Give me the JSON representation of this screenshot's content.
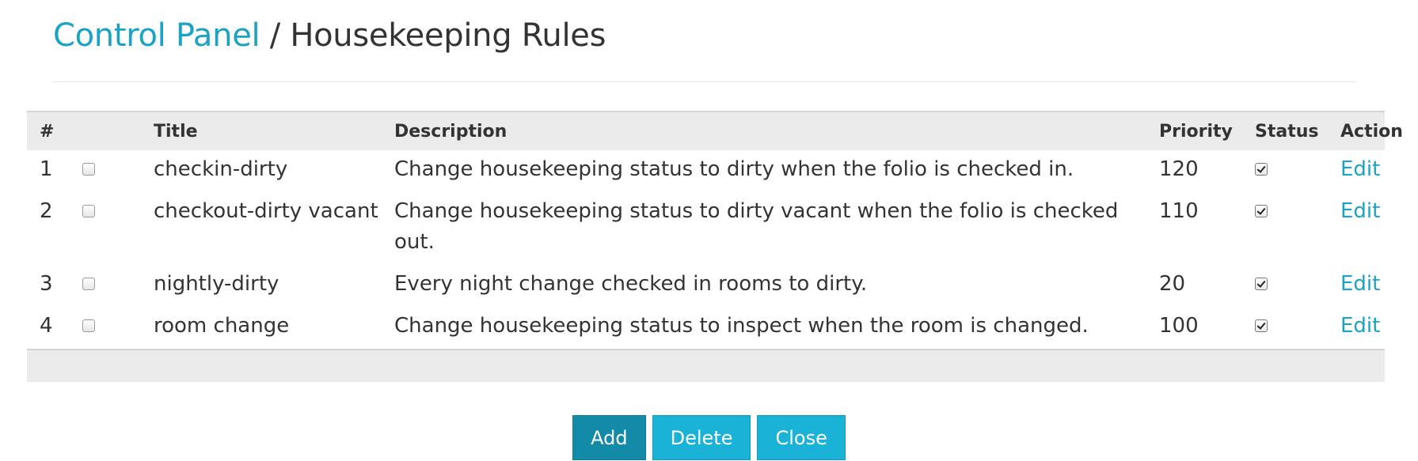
{
  "breadcrumb": {
    "parent": "Control Panel",
    "separator": "/",
    "current": "Housekeeping Rules"
  },
  "table": {
    "headers": {
      "num": "#",
      "title": "Title",
      "description": "Description",
      "priority": "Priority",
      "status": "Status",
      "action": "Action"
    },
    "rows": [
      {
        "num": "1",
        "title": "checkin-dirty",
        "description": "Change housekeeping status to dirty when the folio is checked in.",
        "priority": "120",
        "selected": false,
        "status_checked": true,
        "action": "Edit"
      },
      {
        "num": "2",
        "title": "checkout-dirty vacant",
        "description": "Change housekeeping status to dirty vacant when the folio is checked out.",
        "priority": "110",
        "selected": false,
        "status_checked": true,
        "action": "Edit"
      },
      {
        "num": "3",
        "title": "nightly-dirty",
        "description": "Every night change checked in rooms to dirty.",
        "priority": "20",
        "selected": false,
        "status_checked": true,
        "action": "Edit"
      },
      {
        "num": "4",
        "title": "room change",
        "description": "Change housekeeping status to inspect when the room is changed.",
        "priority": "100",
        "selected": false,
        "status_checked": true,
        "action": "Edit"
      }
    ]
  },
  "buttons": {
    "add": "Add",
    "delete": "Delete",
    "close": "Close"
  },
  "colors": {
    "link": "#1ba3c6",
    "button": "#1ab2d6",
    "button_primary": "#138ba8",
    "header_bg": "#ebebeb"
  }
}
